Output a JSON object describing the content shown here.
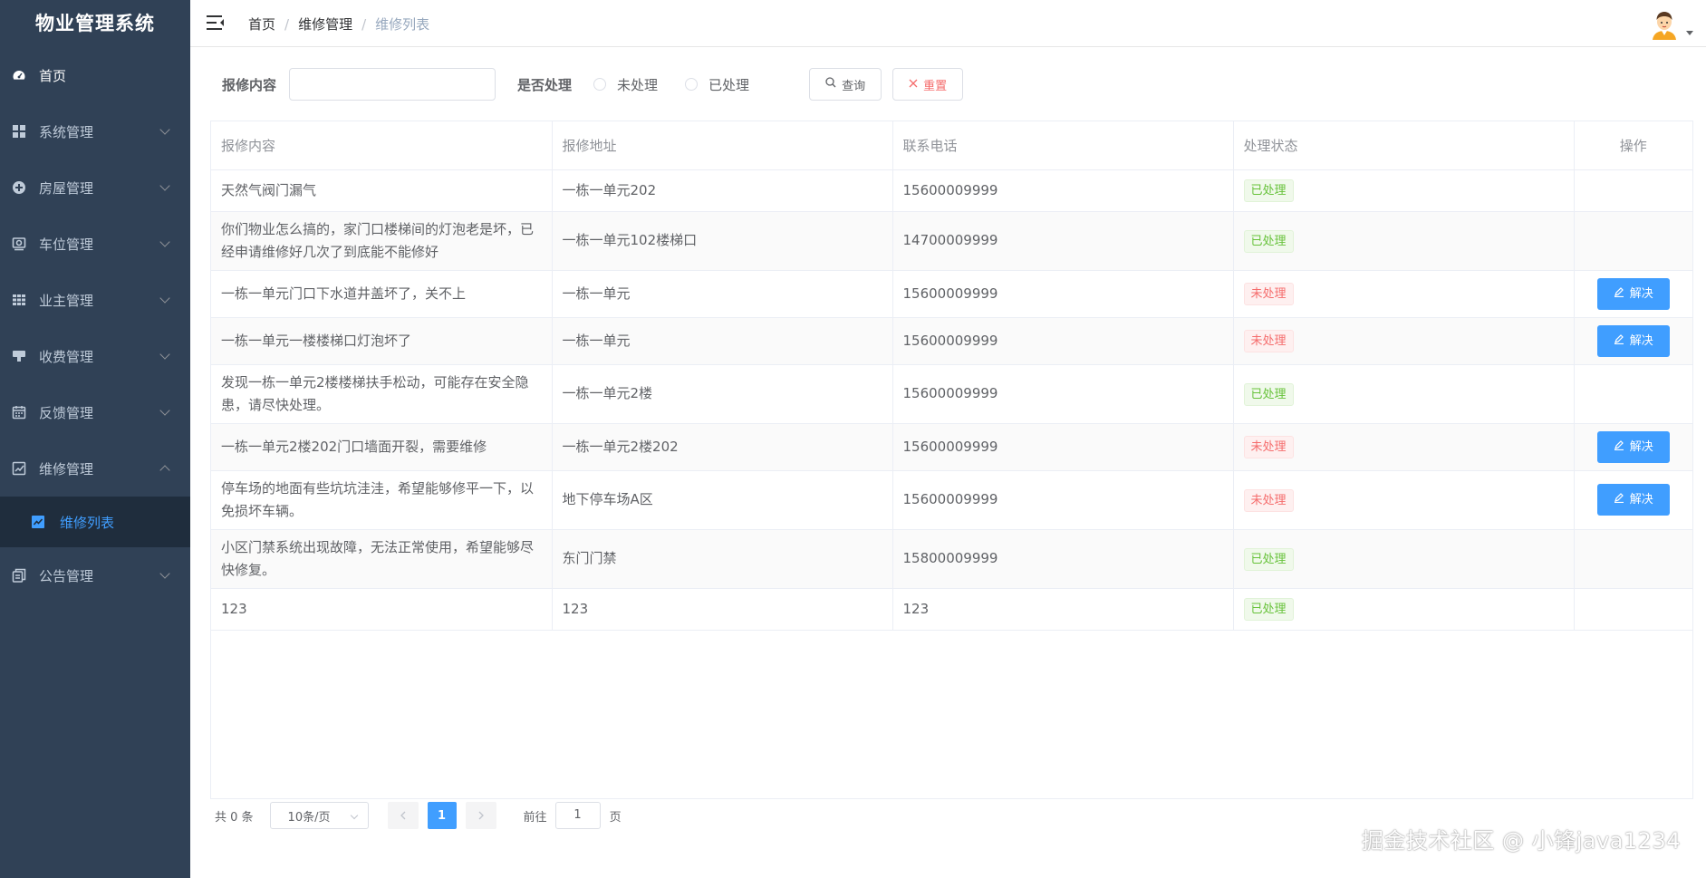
{
  "app": {
    "title": "物业管理系统"
  },
  "sidebar": {
    "items": [
      {
        "label": "首页",
        "icon": "dashboard-icon"
      },
      {
        "label": "系统管理",
        "icon": "grid-icon"
      },
      {
        "label": "房屋管理",
        "icon": "plus-circle-icon"
      },
      {
        "label": "车位管理",
        "icon": "parking-icon"
      },
      {
        "label": "业主管理",
        "icon": "table-icon"
      },
      {
        "label": "收费管理",
        "icon": "money-icon"
      },
      {
        "label": "反馈管理",
        "icon": "calendar-icon"
      },
      {
        "label": "维修管理",
        "icon": "chart-icon"
      },
      {
        "label": "公告管理",
        "icon": "copy-icon"
      }
    ],
    "active_sub": {
      "label": "维修列表",
      "icon": "trend-icon"
    }
  },
  "header": {
    "breadcrumb": [
      "首页",
      "维修管理",
      "维修列表"
    ],
    "separator": "/"
  },
  "search": {
    "content_label": "报修内容",
    "content_value": "",
    "status_label": "是否处理",
    "status_options": [
      "未处理",
      "已处理"
    ],
    "query_label": "查询",
    "reset_label": "重置"
  },
  "table": {
    "columns": [
      "报修内容",
      "报修地址",
      "联系电话",
      "处理状态",
      "操作"
    ],
    "solve_label": "解决",
    "rows": [
      {
        "content": "天然气阀门漏气",
        "address": "一栋一单元202",
        "phone": "15600009999",
        "status": "已处理"
      },
      {
        "content": "你们物业怎么搞的，家门口楼梯间的灯泡老是坏，已经申请维修好几次了到底能不能修好",
        "address": "一栋一单元102楼梯口",
        "phone": "14700009999",
        "status": "已处理"
      },
      {
        "content": "一栋一单元门口下水道井盖坏了，关不上",
        "address": "一栋一单元",
        "phone": "15600009999",
        "status": "未处理"
      },
      {
        "content": "一栋一单元一楼楼梯口灯泡坏了",
        "address": "一栋一单元",
        "phone": "15600009999",
        "status": "未处理"
      },
      {
        "content": "发现一栋一单元2楼楼梯扶手松动，可能存在安全隐患，请尽快处理。",
        "address": "一栋一单元2楼",
        "phone": "15600009999",
        "status": "已处理"
      },
      {
        "content": "一栋一单元2楼202门口墙面开裂，需要维修",
        "address": "一栋一单元2楼202",
        "phone": "15600009999",
        "status": "未处理"
      },
      {
        "content": "停车场的地面有些坑坑洼洼，希望能够修平一下，以免损坏车辆。",
        "address": "地下停车场A区",
        "phone": "15600009999",
        "status": "未处理"
      },
      {
        "content": "小区门禁系统出现故障，无法正常使用，希望能够尽快修复。",
        "address": "东门门禁",
        "phone": "15800009999",
        "status": "已处理"
      },
      {
        "content": "123",
        "address": "123",
        "phone": "123",
        "status": "已处理"
      }
    ]
  },
  "pagination": {
    "total": "共 0 条",
    "page_size": "10条/页",
    "current": "1",
    "goto_prefix": "前往",
    "goto_value": "1",
    "goto_suffix": "页"
  },
  "watermark": "掘金技术社区 @ 小锋java1234",
  "colors": {
    "sidebar": "#304156",
    "accent": "#409eff",
    "done": "#67c23a",
    "todo": "#f56c6c"
  }
}
